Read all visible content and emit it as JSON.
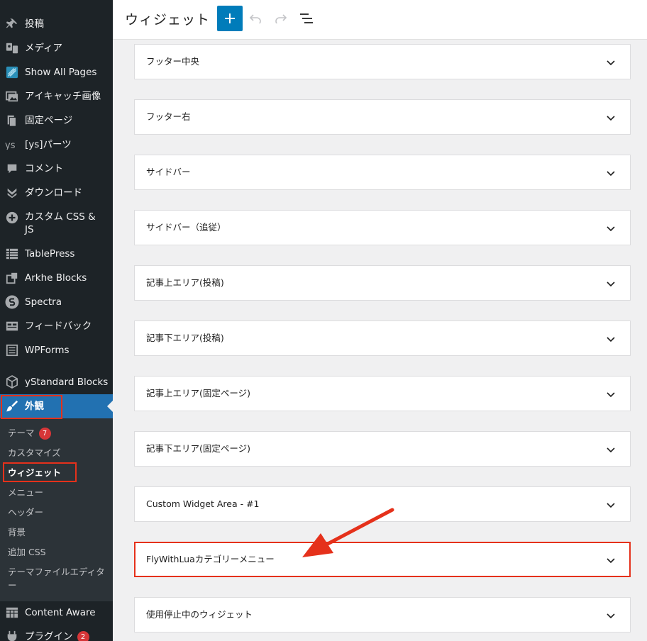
{
  "sidebar": {
    "items": [
      {
        "label": "投稿",
        "icon": "pin-icon"
      },
      {
        "label": "メディア",
        "icon": "media-icon"
      },
      {
        "label": "Show All Pages",
        "icon": "pages-plugin-icon"
      },
      {
        "label": "アイキャッチ画像",
        "icon": "image-icon"
      },
      {
        "label": "固定ページ",
        "icon": "page-icon"
      },
      {
        "label": "[ys]パーツ",
        "icon": "ys-icon"
      },
      {
        "label": "コメント",
        "icon": "comment-icon"
      },
      {
        "label": "ダウンロード",
        "icon": "download-icon"
      },
      {
        "label": "カスタム CSS & JS",
        "icon": "plus-circle-icon"
      },
      {
        "label": "TablePress",
        "icon": "table-icon"
      },
      {
        "label": "Arkhe Blocks",
        "icon": "blocks-icon"
      },
      {
        "label": "Spectra",
        "icon": "spectra-icon"
      },
      {
        "label": "フィードバック",
        "icon": "feedback-icon"
      },
      {
        "label": "WPForms",
        "icon": "forms-icon"
      },
      {
        "label": "yStandard Blocks",
        "icon": "cube-icon"
      },
      {
        "label": "外観",
        "icon": "brush-icon"
      }
    ],
    "submenu": [
      {
        "label": "テーマ",
        "badge": "7"
      },
      {
        "label": "カスタマイズ"
      },
      {
        "label": "ウィジェット"
      },
      {
        "label": "メニュー"
      },
      {
        "label": "ヘッダー"
      },
      {
        "label": "背景"
      },
      {
        "label": "追加 CSS"
      },
      {
        "label": "テーマファイルエディター"
      }
    ],
    "bottom": [
      {
        "label": "Content Aware",
        "icon": "content-aware-icon"
      },
      {
        "label": "プラグイン",
        "icon": "plugin-icon",
        "badge": "2"
      }
    ]
  },
  "header": {
    "title": "ウィジェット",
    "add_icon": "plus-icon",
    "undo_icon": "undo-icon",
    "redo_icon": "redo-icon",
    "list_view_icon": "list-view-icon"
  },
  "panels": [
    {
      "title": "フッター中央"
    },
    {
      "title": "フッター右"
    },
    {
      "title": "サイドバー"
    },
    {
      "title": "サイドバー（追従）"
    },
    {
      "title": "記事上エリア(投稿)"
    },
    {
      "title": "記事下エリア(投稿)"
    },
    {
      "title": "記事上エリア(固定ページ)"
    },
    {
      "title": "記事下エリア(固定ページ)"
    },
    {
      "title": "Custom Widget Area - #1"
    },
    {
      "title": "FlyWithLuaカテゴリーメニュー"
    },
    {
      "title": "使用停止中のウィジェット"
    }
  ],
  "colors": {
    "sidebar_bg": "#1d2327",
    "submenu_bg": "#2c3338",
    "active_bg": "#2271b1",
    "accent": "#007cba",
    "annotation": "#e5311b",
    "badge": "#d63638"
  }
}
